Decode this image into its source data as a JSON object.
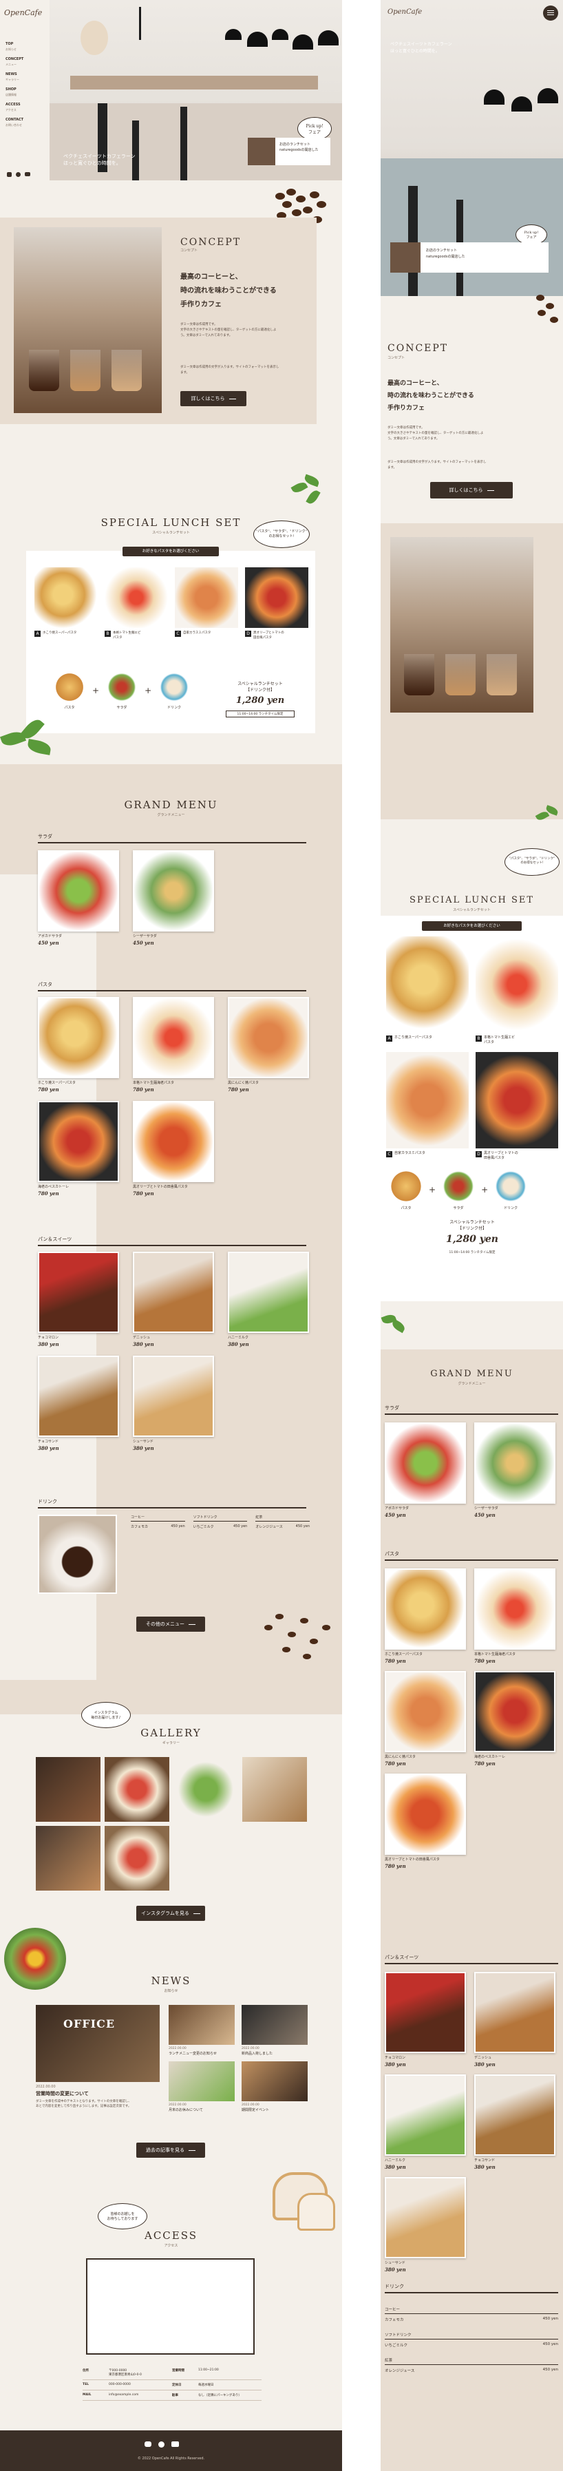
{
  "logo": "OpenCafe",
  "nav": [
    "TOP",
    "お知らせ",
    "CONCEPT",
    "メニュー",
    "NEWS",
    "ギャラリー",
    "SHOP",
    "店舗情報",
    "ACCESS",
    "アクセス",
    "CONTACT",
    "お問い合わせ"
  ],
  "hero": {
    "caption": "ペクチェスイーツトカフェラーン\nほっと寛ぐひとの時間を。",
    "bubble": "Pick up!\nフェア",
    "news_text": "お店のランチセット\nnaturegoodsの開店した"
  },
  "concept": {
    "title": "CONCEPT",
    "sub": "コンセプト",
    "lead": [
      "最高のコーヒーと、",
      "時の流れを味わうことができる",
      "手作りカフェ"
    ],
    "body1": "ダミー文章は作成用です。\n文字の大きさやテキストの量を確認し、ターゲットの方に最適化しよ\nう。文章はダミーで入れてあります。",
    "body2": "ダミー文章は作成用の文字が入ります。サイトのフォーマットを表示し\nます。",
    "button": "詳しくはこちら"
  },
  "lunch": {
    "title": "SPECIAL LUNCH SET",
    "sub": "スペシャルランチセット",
    "bubble": "\"パスタ\"、\"サラダ\"、\"ドリンク\"\nのお得なセット!",
    "band": "お好きなパスタをお選びください",
    "items": [
      {
        "id": "A",
        "name": "ホこり焼スーパーパスタ"
      },
      {
        "id": "B",
        "name": "本格トマト生麺エビ\nパスタ"
      },
      {
        "id": "C",
        "name": "自家カラスミパスタ"
      },
      {
        "id": "D",
        "name": "黒オリーブとトマトの\n田舎風パスタ"
      }
    ],
    "set": [
      "パスタ",
      "サラダ",
      "ドリンク"
    ],
    "plus": "+",
    "set_name": "スペシャルランチセット\n【ドリンク付】",
    "price": "1,280 yen",
    "price_note": "11:00~14:00 ランチタイム限定"
  },
  "menu": {
    "title": "GRAND MENU",
    "sub": "グランドメニュー",
    "salad_tag": "サラダ",
    "pasta_tag": "パスタ",
    "bread_tag": "パン＆スイーツ",
    "drink_tag": "ドリンク",
    "salads": [
      {
        "name": "アボカドサラダ",
        "price": "450 yen"
      },
      {
        "name": "シーザーサラダ",
        "price": "450 yen"
      }
    ],
    "pastas": [
      {
        "name": "ホこり焼スーパーパスタ",
        "price": "780 yen"
      },
      {
        "name": "本格トマト生麺海老パスタ",
        "price": "780 yen"
      },
      {
        "name": "黒にんにく焼パスタ",
        "price": "780 yen"
      },
      {
        "name": "海老のペスカトーレ",
        "price": "780 yen"
      },
      {
        "name": "黒オリーブとトマトの田舎風パスタ",
        "price": "780 yen"
      }
    ],
    "breads": [
      {
        "name": "チョコマロン",
        "price": "380 yen"
      },
      {
        "name": "デニッシュ",
        "price": "380 yen"
      },
      {
        "name": "ハニーミルク",
        "price": "380 yen"
      },
      {
        "name": "チョコサンド",
        "price": "380 yen"
      },
      {
        "name": "シューサンド",
        "price": "380 yen"
      }
    ],
    "drinks": [
      {
        "cat": "コーヒー",
        "name": "カフェモカ",
        "price": "450 yen"
      },
      {
        "cat": "ソフトドリンク",
        "name": "いちごミルク",
        "price": "450 yen"
      },
      {
        "cat": "紅茶",
        "name": "オレンジジュース",
        "price": "450 yen"
      }
    ],
    "button": "その他のメニュー"
  },
  "gallery": {
    "title": "GALLERY",
    "sub": "ギャラリー",
    "bubble": "インスタグラム\n毎日お届けします♪",
    "button": "インスタグラムを見る"
  },
  "news": {
    "title": "NEWS",
    "sub": "お知らせ",
    "main_date": "2022.00.00",
    "main_title": "営業時間の変更について",
    "main_body": "ダミー文章を作成中のテキストとなります。サイトの文章を確認し、\nあとで内容を変更して作り直すようにします。記事は設定次第です。",
    "items": [
      {
        "date": "2022.00.00",
        "title": "ランチメニュー変更のお知らせ"
      },
      {
        "date": "2022.00.00",
        "title": "新商品入荷しました"
      },
      {
        "date": "2022.00.00",
        "title": "月末のお休みについて"
      },
      {
        "date": "2022.00.00",
        "title": "期間限定イベント"
      }
    ],
    "button": "過去の記事を見る"
  },
  "access": {
    "title": "ACCESS",
    "sub": "アクセス",
    "bubble": "皆様のお越しを\nお待ちしております",
    "rows": [
      [
        "住所",
        "〒000-0000\n東京都港区南青山0-0-0",
        "営業時間",
        "11:00~21:00"
      ],
      [
        "TEL",
        "000-000-0000",
        "定休日",
        "毎週水曜日"
      ],
      [
        "MAIL",
        "info@example.com",
        "駐車",
        "なし（近隣にパーキングあり）"
      ]
    ]
  },
  "footer": {
    "copyright": "© 2022 OpenCafe All Rights Reserved.",
    "sns": [
      "twitter-icon",
      "facebook-icon",
      "youtube-icon"
    ]
  },
  "colors": {
    "dark": "#3b2f27",
    "beige": "#e8ddd1",
    "cream": "#f4f0ea",
    "brown": "#b48a6a"
  }
}
